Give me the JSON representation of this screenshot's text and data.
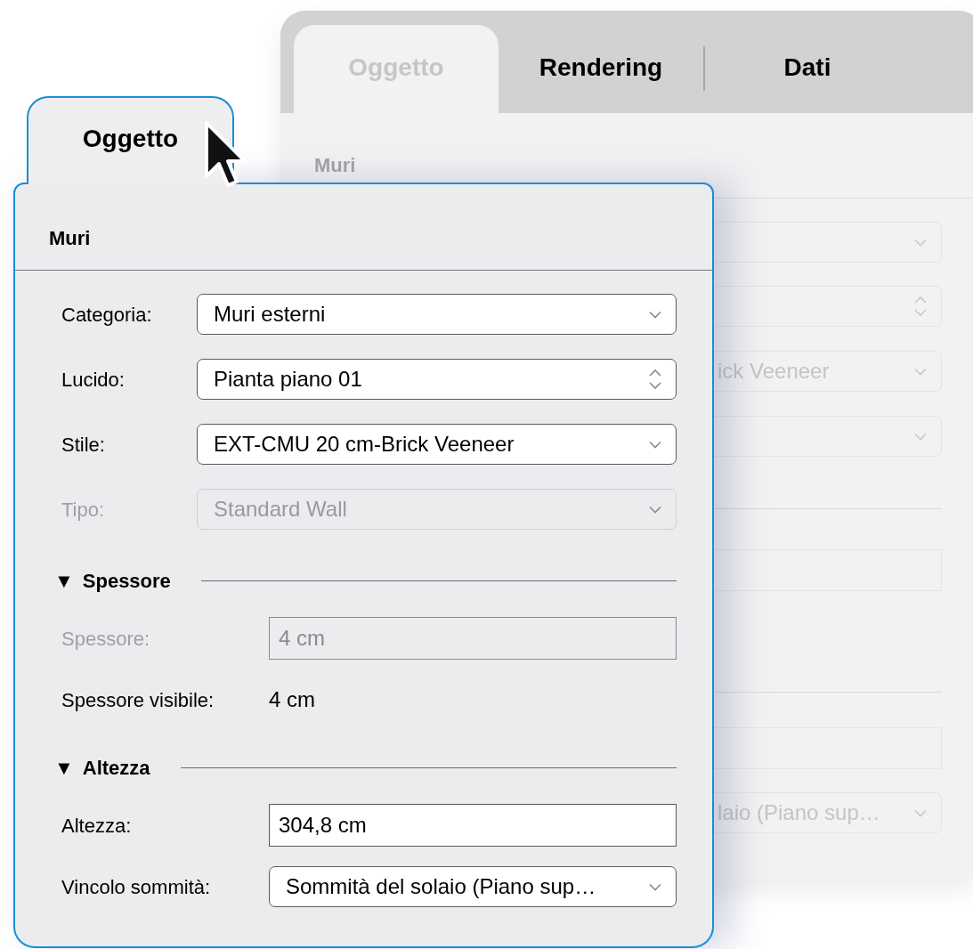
{
  "back_panel": {
    "tabs": [
      {
        "label": "Oggetto",
        "selected": true
      },
      {
        "label": "Rendering",
        "selected": false
      },
      {
        "label": "Dati",
        "selected": false
      }
    ],
    "section": "Muri",
    "fields": [
      {
        "kind": "dropdown"
      },
      {
        "kind": "stepper"
      },
      {
        "kind": "dropdown",
        "value": "ick Veeneer"
      },
      {
        "kind": "dropdown"
      },
      {
        "kind": "rule"
      },
      {
        "kind": "input"
      },
      {
        "kind": "rule"
      },
      {
        "kind": "input"
      },
      {
        "kind": "dropdown",
        "value": "laio (Piano sup…"
      }
    ]
  },
  "front_panel": {
    "tab": "Oggetto",
    "section": "Muri",
    "rows": [
      {
        "kind": "dropdown",
        "label": "Categoria:",
        "value": "Muri esterni",
        "disabled": false
      },
      {
        "kind": "stepper",
        "label": "Lucido:",
        "value": "Pianta piano 01",
        "disabled": false
      },
      {
        "kind": "dropdown",
        "label": "Stile:",
        "value": "EXT-CMU 20 cm-Brick Veeneer",
        "disabled": false
      },
      {
        "kind": "dropdown",
        "label": "Tipo:",
        "value": "Standard Wall",
        "disabled": true
      }
    ],
    "groups": [
      {
        "toggle": "▼",
        "title": "Spessore",
        "rows": [
          {
            "kind": "input",
            "label": "Spessore:",
            "value": "4 cm",
            "disabled": true
          },
          {
            "kind": "text",
            "label": "Spessore visibile:",
            "value": "4 cm",
            "disabled": false
          }
        ]
      },
      {
        "toggle": "▼",
        "title": "Altezza",
        "rows": [
          {
            "kind": "input",
            "label": "Altezza:",
            "value": "304,8 cm",
            "disabled": false
          },
          {
            "kind": "dropdown",
            "label": "Vincolo sommità:",
            "value": "Sommità del solaio (Piano sup…",
            "disabled": false
          }
        ]
      }
    ]
  }
}
